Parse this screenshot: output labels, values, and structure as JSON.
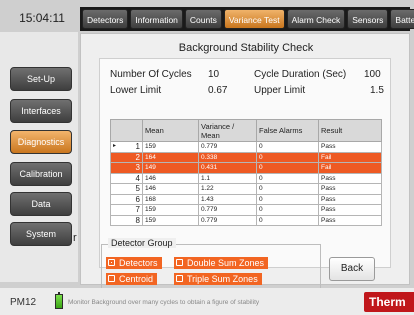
{
  "clock": "15:04:11",
  "tabs": [
    {
      "label": "Detectors"
    },
    {
      "label": "Information"
    },
    {
      "label": "Counts"
    },
    {
      "label": "Variance Test"
    },
    {
      "label": "Alarm Check"
    },
    {
      "label": "Sensors"
    },
    {
      "label": "Battery"
    }
  ],
  "active_tab": "Variance Test",
  "sidebar": {
    "items": [
      {
        "label": "Set-Up"
      },
      {
        "label": "Interfaces"
      },
      {
        "label": "Diagnostics"
      },
      {
        "label": "Calibration"
      },
      {
        "label": "Data"
      },
      {
        "label": "System"
      }
    ],
    "active": "Diagnostics",
    "overflow_text": "r"
  },
  "page_title": "Background Stability Check",
  "params": {
    "cycles_label": "Number Of Cycles",
    "cycles_value": "10",
    "duration_label": "Cycle Duration (Sec)",
    "duration_value": "100",
    "lower_label": "Lower Limit",
    "lower_value": "0.67",
    "upper_label": "Upper Limit",
    "upper_value": "1.5"
  },
  "table": {
    "headers": [
      "",
      "Mean",
      "Variance / Mean",
      "False Alarms",
      "Result"
    ],
    "rows": [
      {
        "idx": "1",
        "mean": "159",
        "vm": "0.779",
        "fa": "0",
        "result": "Pass",
        "fail": false,
        "selected": true
      },
      {
        "idx": "2",
        "mean": "164",
        "vm": "0.338",
        "fa": "0",
        "result": "Fail",
        "fail": true,
        "selected": false
      },
      {
        "idx": "3",
        "mean": "149",
        "vm": "0.431",
        "fa": "0",
        "result": "Fail",
        "fail": true,
        "selected": false
      },
      {
        "idx": "4",
        "mean": "146",
        "vm": "1.1",
        "fa": "0",
        "result": "Pass",
        "fail": false,
        "selected": false
      },
      {
        "idx": "5",
        "mean": "146",
        "vm": "1.22",
        "fa": "0",
        "result": "Pass",
        "fail": false,
        "selected": false
      },
      {
        "idx": "6",
        "mean": "168",
        "vm": "1.43",
        "fa": "0",
        "result": "Pass",
        "fail": false,
        "selected": false
      },
      {
        "idx": "7",
        "mean": "159",
        "vm": "0.779",
        "fa": "0",
        "result": "Pass",
        "fail": false,
        "selected": false
      },
      {
        "idx": "8",
        "mean": "159",
        "vm": "0.779",
        "fa": "0",
        "result": "Pass",
        "fail": false,
        "selected": false
      }
    ]
  },
  "detector_group": {
    "title": "Detector Group",
    "options": [
      {
        "label": "Detectors",
        "checked": true
      },
      {
        "label": "Double Sum Zones",
        "checked": false
      },
      {
        "label": "Centroid",
        "checked": false
      },
      {
        "label": "Triple Sum Zones",
        "checked": false
      }
    ]
  },
  "back_label": "Back",
  "status": {
    "pm": "PM12",
    "hint": "Monitor Background over many cycles to obtain a figure of stability",
    "logo": "Therm"
  },
  "colors": {
    "accent": "#f26522",
    "tab_active": "#e39a47",
    "fail_row": "#ee5a24",
    "logo": "#c0171b"
  }
}
